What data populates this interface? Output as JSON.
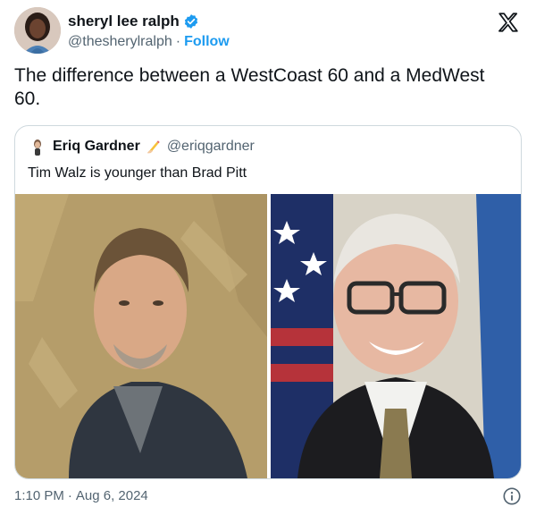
{
  "author": {
    "name": "sheryl lee ralph",
    "handle": "@thesherylralph",
    "separator": "·",
    "follow_label": "Follow"
  },
  "tweet": {
    "text": "The difference between a WestCoast 60 and a MedWest 60."
  },
  "quoted": {
    "name": "Eriq Gardner",
    "handle": "@eriqgardner",
    "text": "Tim Walz is younger than Brad Pitt"
  },
  "footer": {
    "time": "1:10 PM",
    "separator": "·",
    "date": "Aug 6, 2024"
  },
  "icons": {
    "verified": "verified-badge-icon",
    "platform": "x-logo-icon",
    "info": "info-icon",
    "writing": "writing-hand-emoji"
  },
  "colors": {
    "accent": "#1d9bf0",
    "text": "#0f1419",
    "muted": "#536471",
    "border": "#cfd9de"
  }
}
